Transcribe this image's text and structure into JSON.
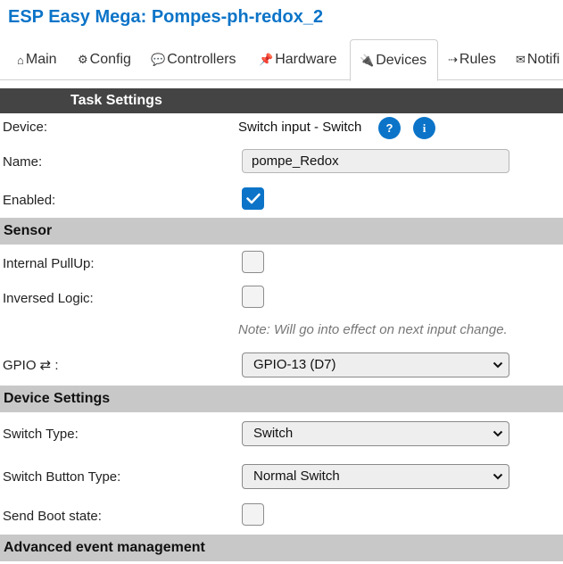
{
  "app_title": "ESP Easy Mega: Pompes-ph-redox_2",
  "tabs": [
    {
      "icon": "⌂",
      "label": "Main"
    },
    {
      "icon": "⚙",
      "label": "Config"
    },
    {
      "icon": "💬",
      "label": "Controllers"
    },
    {
      "icon": "📌",
      "label": "Hardware"
    },
    {
      "icon": "🔌",
      "label": "Devices"
    },
    {
      "icon": "⇢",
      "label": "Rules"
    },
    {
      "icon": "✉",
      "label": "Notifi"
    }
  ],
  "task_settings": {
    "header": "Task Settings",
    "device_label": "Device:",
    "device_value": "Switch input - Switch",
    "help_glyph": "?",
    "info_glyph": "i",
    "name_label": "Name:",
    "name_value": "pompe_Redox",
    "enabled_label": "Enabled:",
    "enabled": true
  },
  "sensor": {
    "header": "Sensor",
    "pullup_label": "Internal PullUp:",
    "pullup": false,
    "inversed_label": "Inversed Logic:",
    "inversed": false,
    "note": "Note: Will go into effect on next input change.",
    "gpio_label": "GPIO ⇄ :",
    "gpio_value": "GPIO-13 (D7)"
  },
  "device_settings": {
    "header": "Device Settings",
    "switch_type_label": "Switch Type:",
    "switch_type_value": "Switch",
    "button_type_label": "Switch Button Type:",
    "button_type_value": "Normal Switch",
    "boot_state_label": "Send Boot state:",
    "boot_state": false
  },
  "advanced": {
    "header": "Advanced event management"
  },
  "colors": {
    "accent": "#0b74c8",
    "dark_bar": "#444444",
    "section_bar": "#c8c8c8"
  }
}
